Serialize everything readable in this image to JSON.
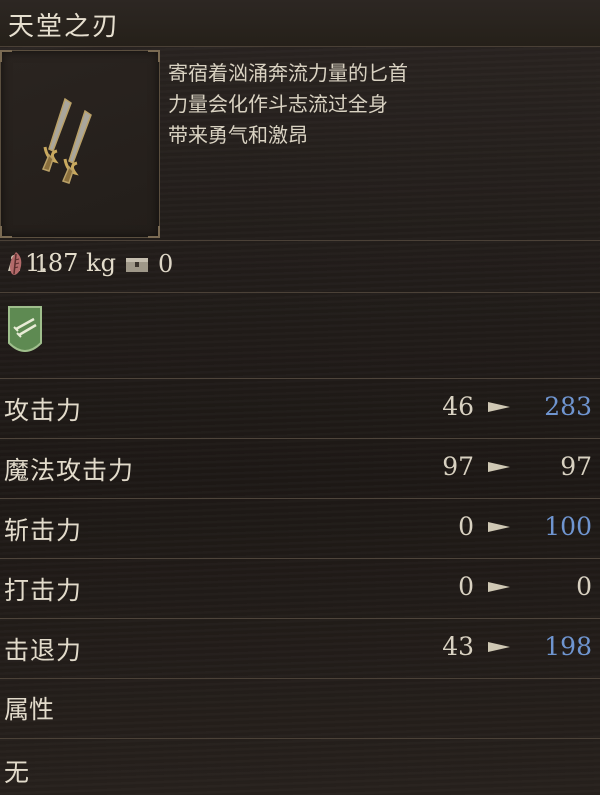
{
  "item": {
    "title": "天堂之刃",
    "weight": "1.87 kg",
    "description": [
      "寄宿着汹涌奔流力量的匕首",
      "力量会化作斗志流过全身",
      "带来勇气和激昂"
    ],
    "icon": "twin-daggers-icon"
  },
  "counts": {
    "owned": "1",
    "stored": "0",
    "owned_icon": "feather-token-icon",
    "stored_icon": "chest-icon"
  },
  "category_badge_icon": "dagger-class-shield-icon",
  "stats": [
    {
      "label": "攻击力",
      "old": "46",
      "new": "283",
      "state": "up"
    },
    {
      "label": "魔法攻击力",
      "old": "97",
      "new": "97",
      "state": "same"
    },
    {
      "label": "斩击力",
      "old": "0",
      "new": "100",
      "state": "up"
    },
    {
      "label": "打击力",
      "old": "0",
      "new": "0",
      "state": "same"
    },
    {
      "label": "击退力",
      "old": "43",
      "new": "198",
      "state": "up"
    }
  ],
  "attribute": {
    "label": "属性",
    "value": "无"
  },
  "colors": {
    "increase": "#6f95d0",
    "neutral": "#d8d1c1",
    "gold_frame": "#7a6a52"
  }
}
